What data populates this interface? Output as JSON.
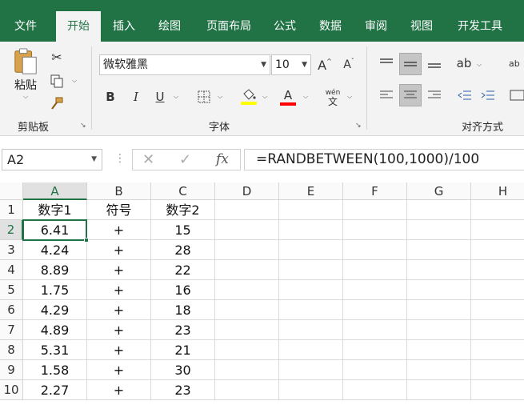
{
  "tabs": [
    "文件",
    "开始",
    "插入",
    "绘图",
    "页面布局",
    "公式",
    "数据",
    "审阅",
    "视图",
    "开发工具"
  ],
  "ribbon": {
    "clipboard": {
      "paste_label": "粘贴",
      "group_label": "剪贴板"
    },
    "font": {
      "name": "微软雅黑",
      "size": "10",
      "group_label": "字体",
      "bold": "B",
      "italic": "I",
      "underline": "U",
      "wen_top": "wén",
      "wen_bottom": "文",
      "increase": "A",
      "decrease": "A",
      "fill_color": "#ffff00",
      "font_color": "#ff0000"
    },
    "alignment": {
      "group_label": "对齐方式",
      "wrap_partial": "ab\nc"
    }
  },
  "formula_bar": {
    "name_box": "A2",
    "formula": "=RANDBETWEEN(100,1000)/100",
    "fx": "fx"
  },
  "grid": {
    "columns": [
      "A",
      "B",
      "C",
      "D",
      "E",
      "F",
      "G",
      "H"
    ],
    "rows": [
      "1",
      "2",
      "3",
      "4",
      "5",
      "6",
      "7",
      "8",
      "9",
      "10"
    ],
    "data": [
      [
        "数字1",
        "符号",
        "数字2"
      ],
      [
        "6.41",
        "+",
        "15"
      ],
      [
        "4.24",
        "+",
        "28"
      ],
      [
        "8.89",
        "+",
        "22"
      ],
      [
        "1.75",
        "+",
        "16"
      ],
      [
        "4.29",
        "+",
        "18"
      ],
      [
        "4.89",
        "+",
        "23"
      ],
      [
        "5.31",
        "+",
        "21"
      ],
      [
        "1.58",
        "+",
        "30"
      ],
      [
        "2.27",
        "+",
        "23"
      ]
    ],
    "selected_cell": "A2"
  },
  "colors": {
    "accent": "#217346",
    "header_bg": "#fafafa",
    "gridline": "#dadada"
  }
}
